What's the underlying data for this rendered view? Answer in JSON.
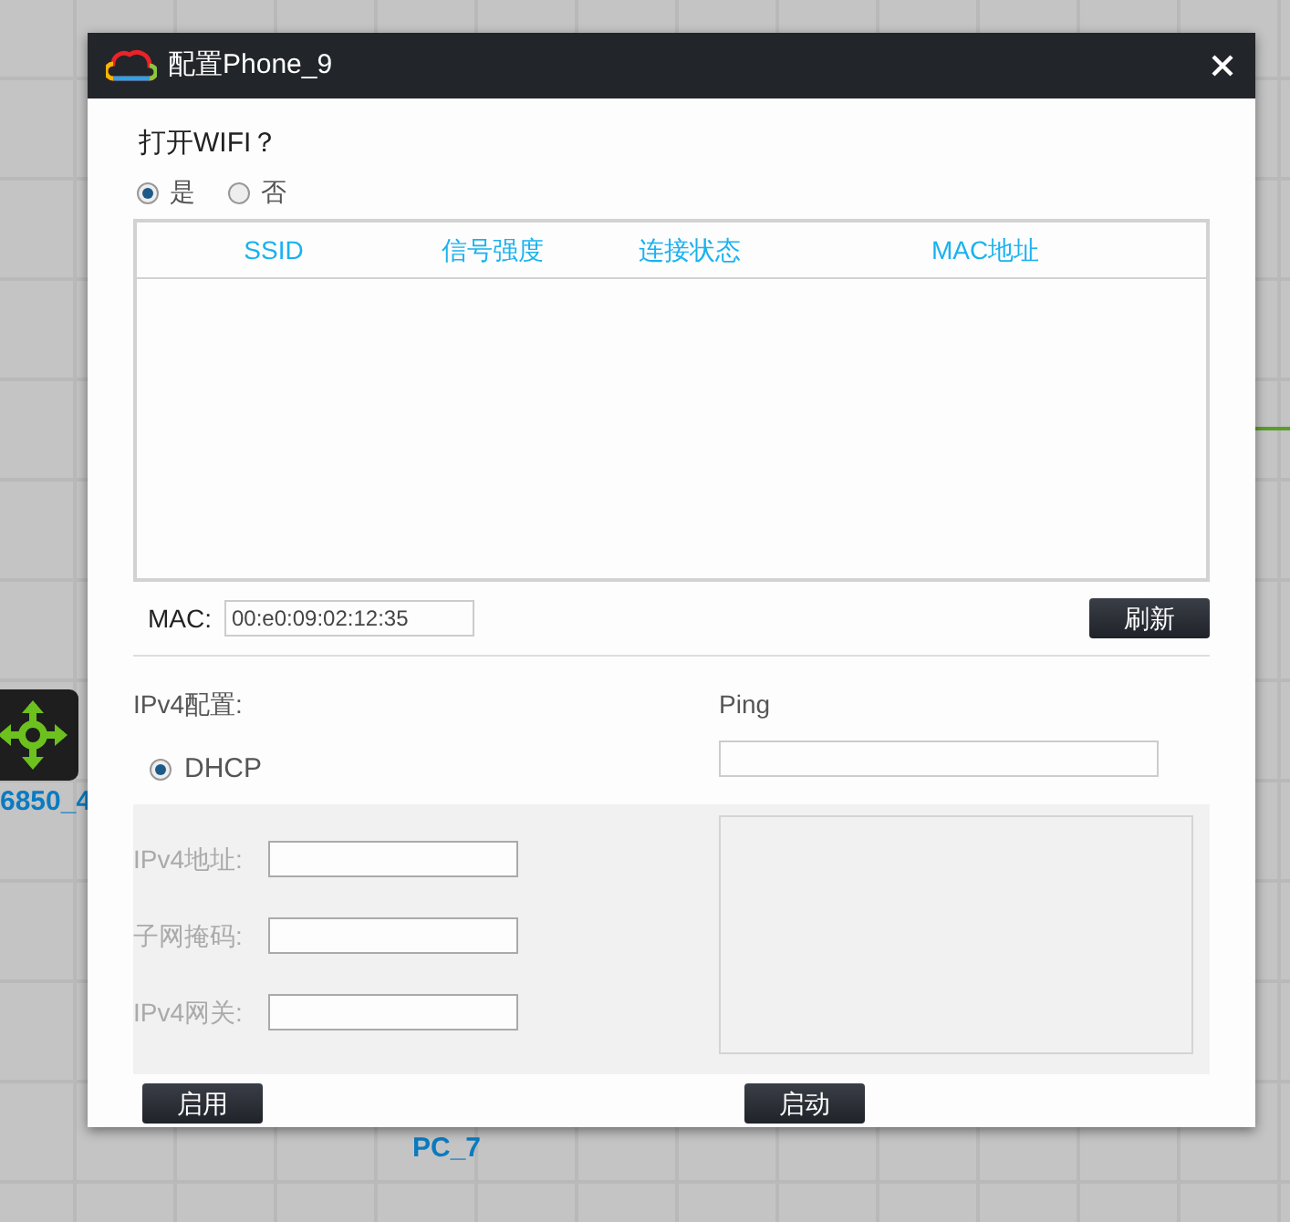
{
  "canvas": {
    "nodes": [
      {
        "label": "6850_4"
      },
      {
        "label": "PC_7"
      }
    ]
  },
  "dialog": {
    "title": "配置Phone_9",
    "wifi": {
      "question": "打开WIFI？",
      "options": [
        {
          "label": "是",
          "selected": true
        },
        {
          "label": "否",
          "selected": false
        }
      ]
    },
    "table": {
      "columns": [
        "SSID",
        "信号强度",
        "连接状态",
        "MAC地址"
      ]
    },
    "mac": {
      "label": "MAC:",
      "value": "00:e0:09:02:12:35"
    },
    "refresh_button": "刷新",
    "ipv4": {
      "title": "IPv4配置:",
      "dhcp": {
        "label": "DHCP",
        "selected": true
      },
      "fields": [
        {
          "label": "IPv4地址:",
          "disabled": true
        },
        {
          "label": "子网掩码:",
          "disabled": true
        },
        {
          "label": "IPv4网关:",
          "disabled": true
        }
      ],
      "apply_button": "启用"
    },
    "ping": {
      "title": "Ping",
      "start_button": "启动"
    }
  }
}
